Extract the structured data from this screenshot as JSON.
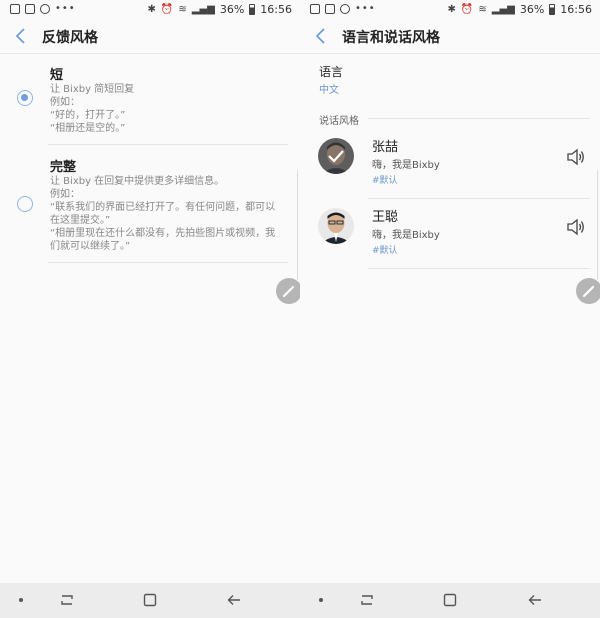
{
  "status_bar": {
    "battery": "36%",
    "time": "16:56"
  },
  "left_screen": {
    "title": "反馈风格",
    "options": [
      {
        "title": "短",
        "selected": true,
        "lines": [
          "让 Bixby 简短回复",
          "例如：",
          "“好的，打开了。”",
          "“相册还是空的。”"
        ]
      },
      {
        "title": "完整",
        "selected": false,
        "lines": [
          "让 Bixby 在回复中提供更多详细信息。",
          "例如：",
          "“联系我们的界面已经打开了。有任何问题，都可以",
          "在这里提交。”",
          "“相册里现在还什么都没有，先拍些图片或视频，我",
          "们就可以继续了。”"
        ]
      }
    ]
  },
  "right_screen": {
    "title": "语言和说话风格",
    "language_label": "语言",
    "language_value": "中文",
    "group_header": "说话风格",
    "voices": [
      {
        "name": "张喆",
        "greeting": "嗨，我是Bixby",
        "tag": "#默认",
        "selected": true
      },
      {
        "name": "王聪",
        "greeting": "嗨，我是Bixby",
        "tag": "#默认",
        "selected": false
      }
    ]
  },
  "icons": {
    "back": "chevron-left-icon",
    "edit": "pencil-icon",
    "speaker": "speaker-icon",
    "nav_recent": "recent-apps-icon",
    "nav_home": "home-icon",
    "nav_back": "back-arrow-icon"
  },
  "colors": {
    "accent": "#6f9fe0",
    "tag_blue": "#6f97cf",
    "background": "#fafafa",
    "navbar": "#ececec"
  }
}
